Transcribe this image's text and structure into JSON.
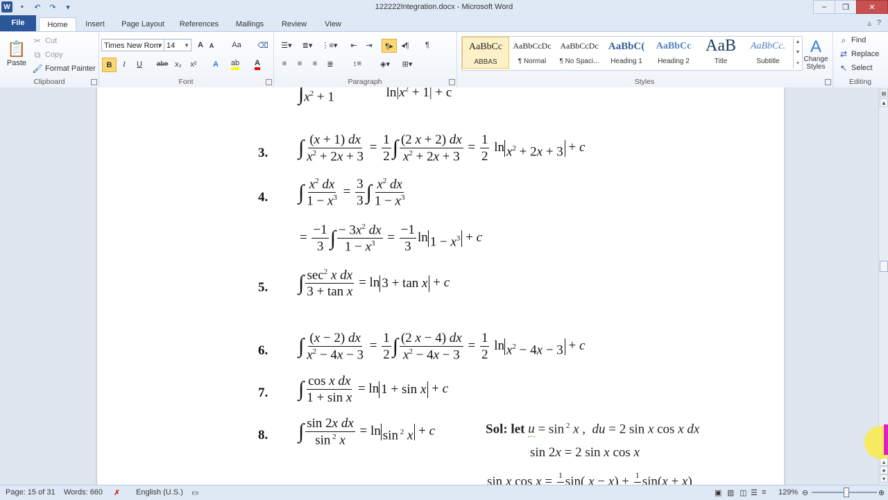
{
  "window": {
    "title": "122222Integration.docx - Microsoft Word",
    "controls": [
      "–",
      "❐",
      "✕"
    ]
  },
  "qat": {
    "logo": "W",
    "icons": [
      "save-icon",
      "undo-icon",
      "redo-icon",
      "customize-icon"
    ]
  },
  "tabs": [
    {
      "label": "File"
    },
    {
      "label": "Home"
    },
    {
      "label": "Insert"
    },
    {
      "label": "Page Layout"
    },
    {
      "label": "References"
    },
    {
      "label": "Mailings"
    },
    {
      "label": "Review"
    },
    {
      "label": "View"
    }
  ],
  "clipboard": {
    "paste": "Paste",
    "cut": "Cut",
    "copy": "Copy",
    "format_painter": "Format Painter",
    "label": "Clipboard"
  },
  "font": {
    "name": "Times New Rom",
    "size": "14",
    "label": "Font",
    "bold": "B",
    "italic": "I",
    "underline": "U",
    "strike": "abe",
    "sub": "x₂",
    "sup": "x²",
    "grow": "A",
    "shrink": "A",
    "case": "Aa"
  },
  "paragraph": {
    "label": "Paragraph"
  },
  "styles": {
    "label": "Styles",
    "items": [
      {
        "sample": "AaBbCc",
        "name": "ABBAS"
      },
      {
        "sample": "AaBbCcDc",
        "name": "¶ Normal"
      },
      {
        "sample": "AaBbCcDc",
        "name": "¶ No Spaci..."
      },
      {
        "sample": "AaBbC(",
        "name": "Heading 1"
      },
      {
        "sample": "AaBbCc",
        "name": "Heading 2"
      },
      {
        "sample": "AaB",
        "name": "Title"
      },
      {
        "sample": "AaBbCc.",
        "name": "Subtitle"
      }
    ],
    "change_styles": "Change Styles"
  },
  "editing": {
    "label": "Editing",
    "find": "Find",
    "replace": "Replace",
    "select": "Select"
  },
  "document": {
    "problems": [
      {
        "num": "3."
      },
      {
        "num": "4."
      },
      {
        "num": "5."
      },
      {
        "num": "6."
      },
      {
        "num": "7."
      },
      {
        "num": "8."
      }
    ],
    "sol_label": "Sol: let"
  },
  "status": {
    "page": "Page: 15 of 31",
    "words": "Words: 660",
    "language": "English (U.S.)",
    "zoom": "129%"
  }
}
